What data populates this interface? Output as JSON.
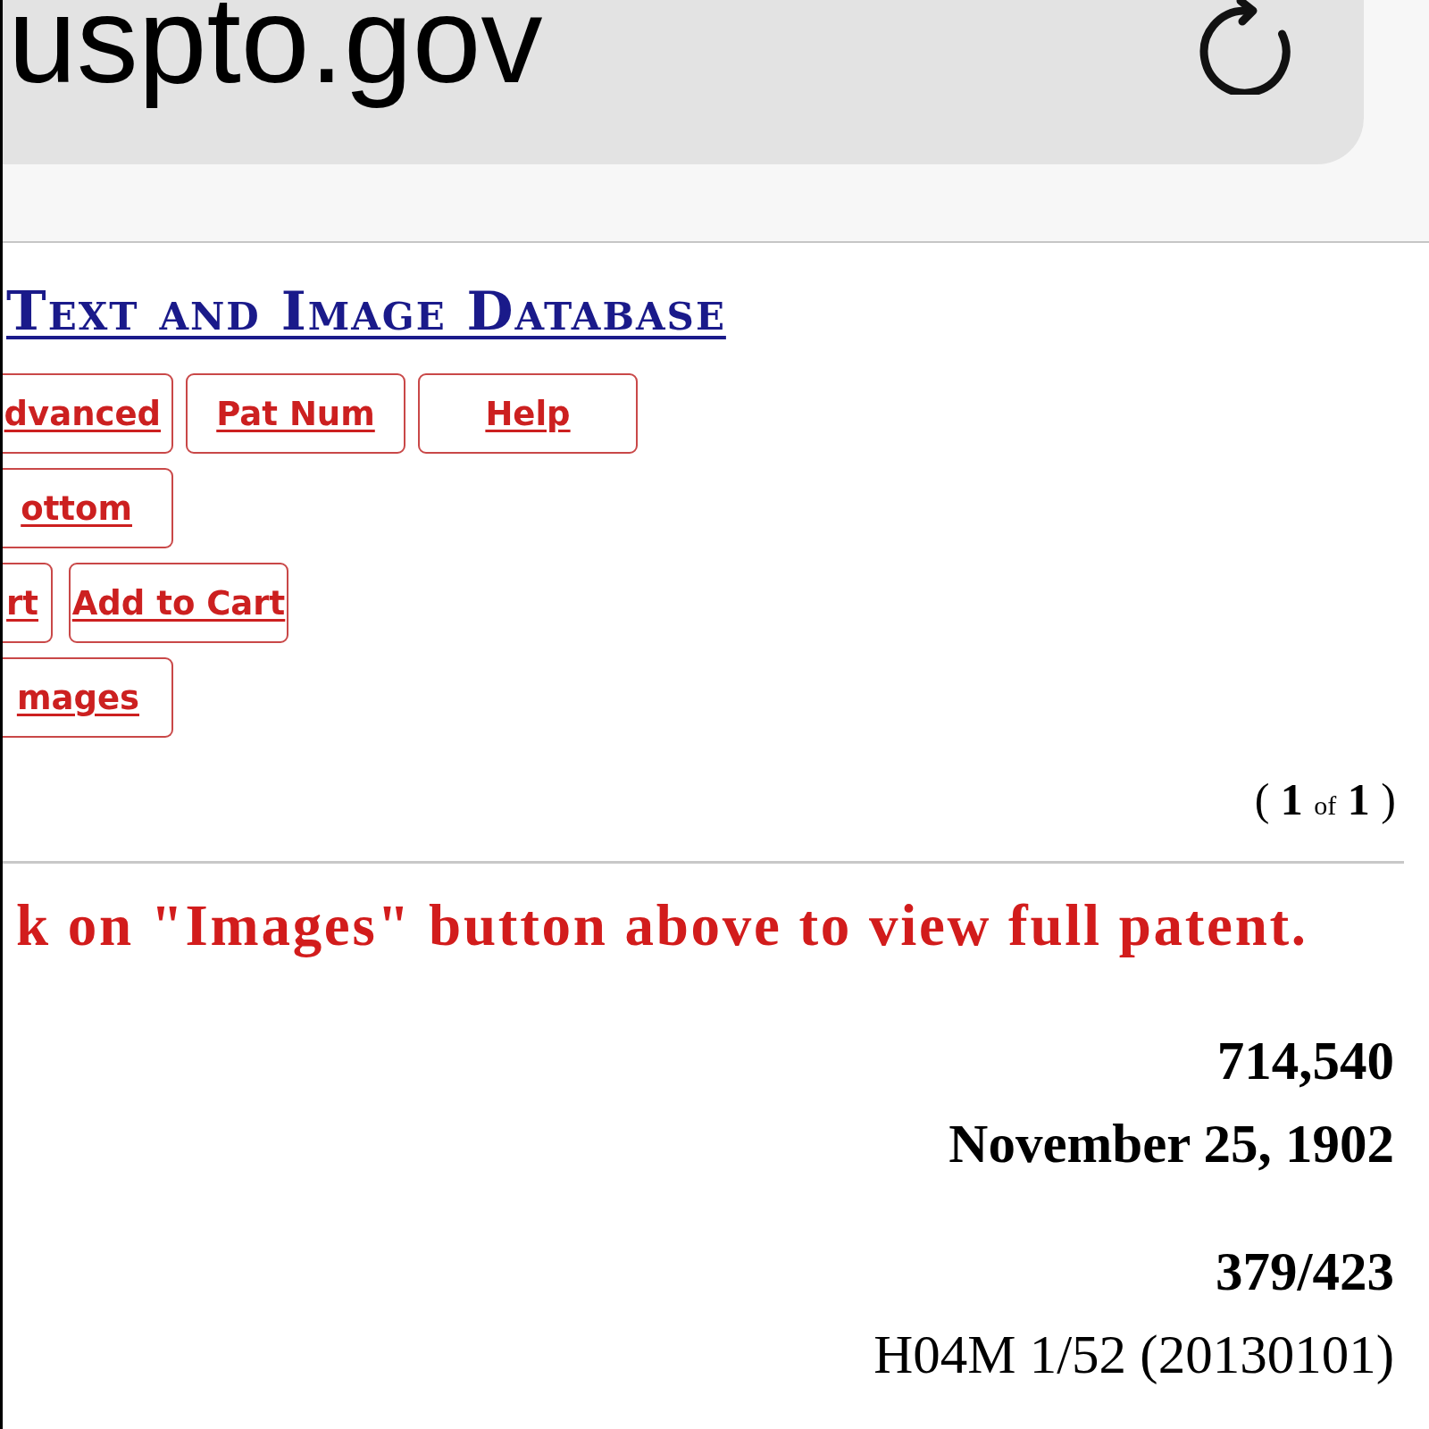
{
  "browser": {
    "url": "uspto.gov"
  },
  "page": {
    "title": "Text and Image Database",
    "button_rows": [
      {
        "buttons": [
          {
            "label": "dvanced"
          },
          {
            "label": "Pat Num"
          },
          {
            "label": "Help"
          }
        ]
      },
      {
        "buttons": [
          {
            "label": "ottom"
          }
        ]
      },
      {
        "buttons": [
          {
            "label": "rt"
          },
          {
            "label": "Add to Cart"
          }
        ]
      },
      {
        "buttons": [
          {
            "label": "mages"
          }
        ]
      }
    ],
    "pager": {
      "open": "(",
      "current": "1",
      "separator": "of",
      "total": "1",
      "close": ")"
    },
    "notice": "k on \"Images\" button above to view full patent.",
    "fields": [
      {
        "value": "714,540",
        "bold": true
      },
      {
        "value": "November 25, 1902",
        "bold": true
      },
      {
        "value": "379/423",
        "bold": true
      },
      {
        "value": "H04M 1/52 (20130101)",
        "bold": false
      }
    ]
  }
}
